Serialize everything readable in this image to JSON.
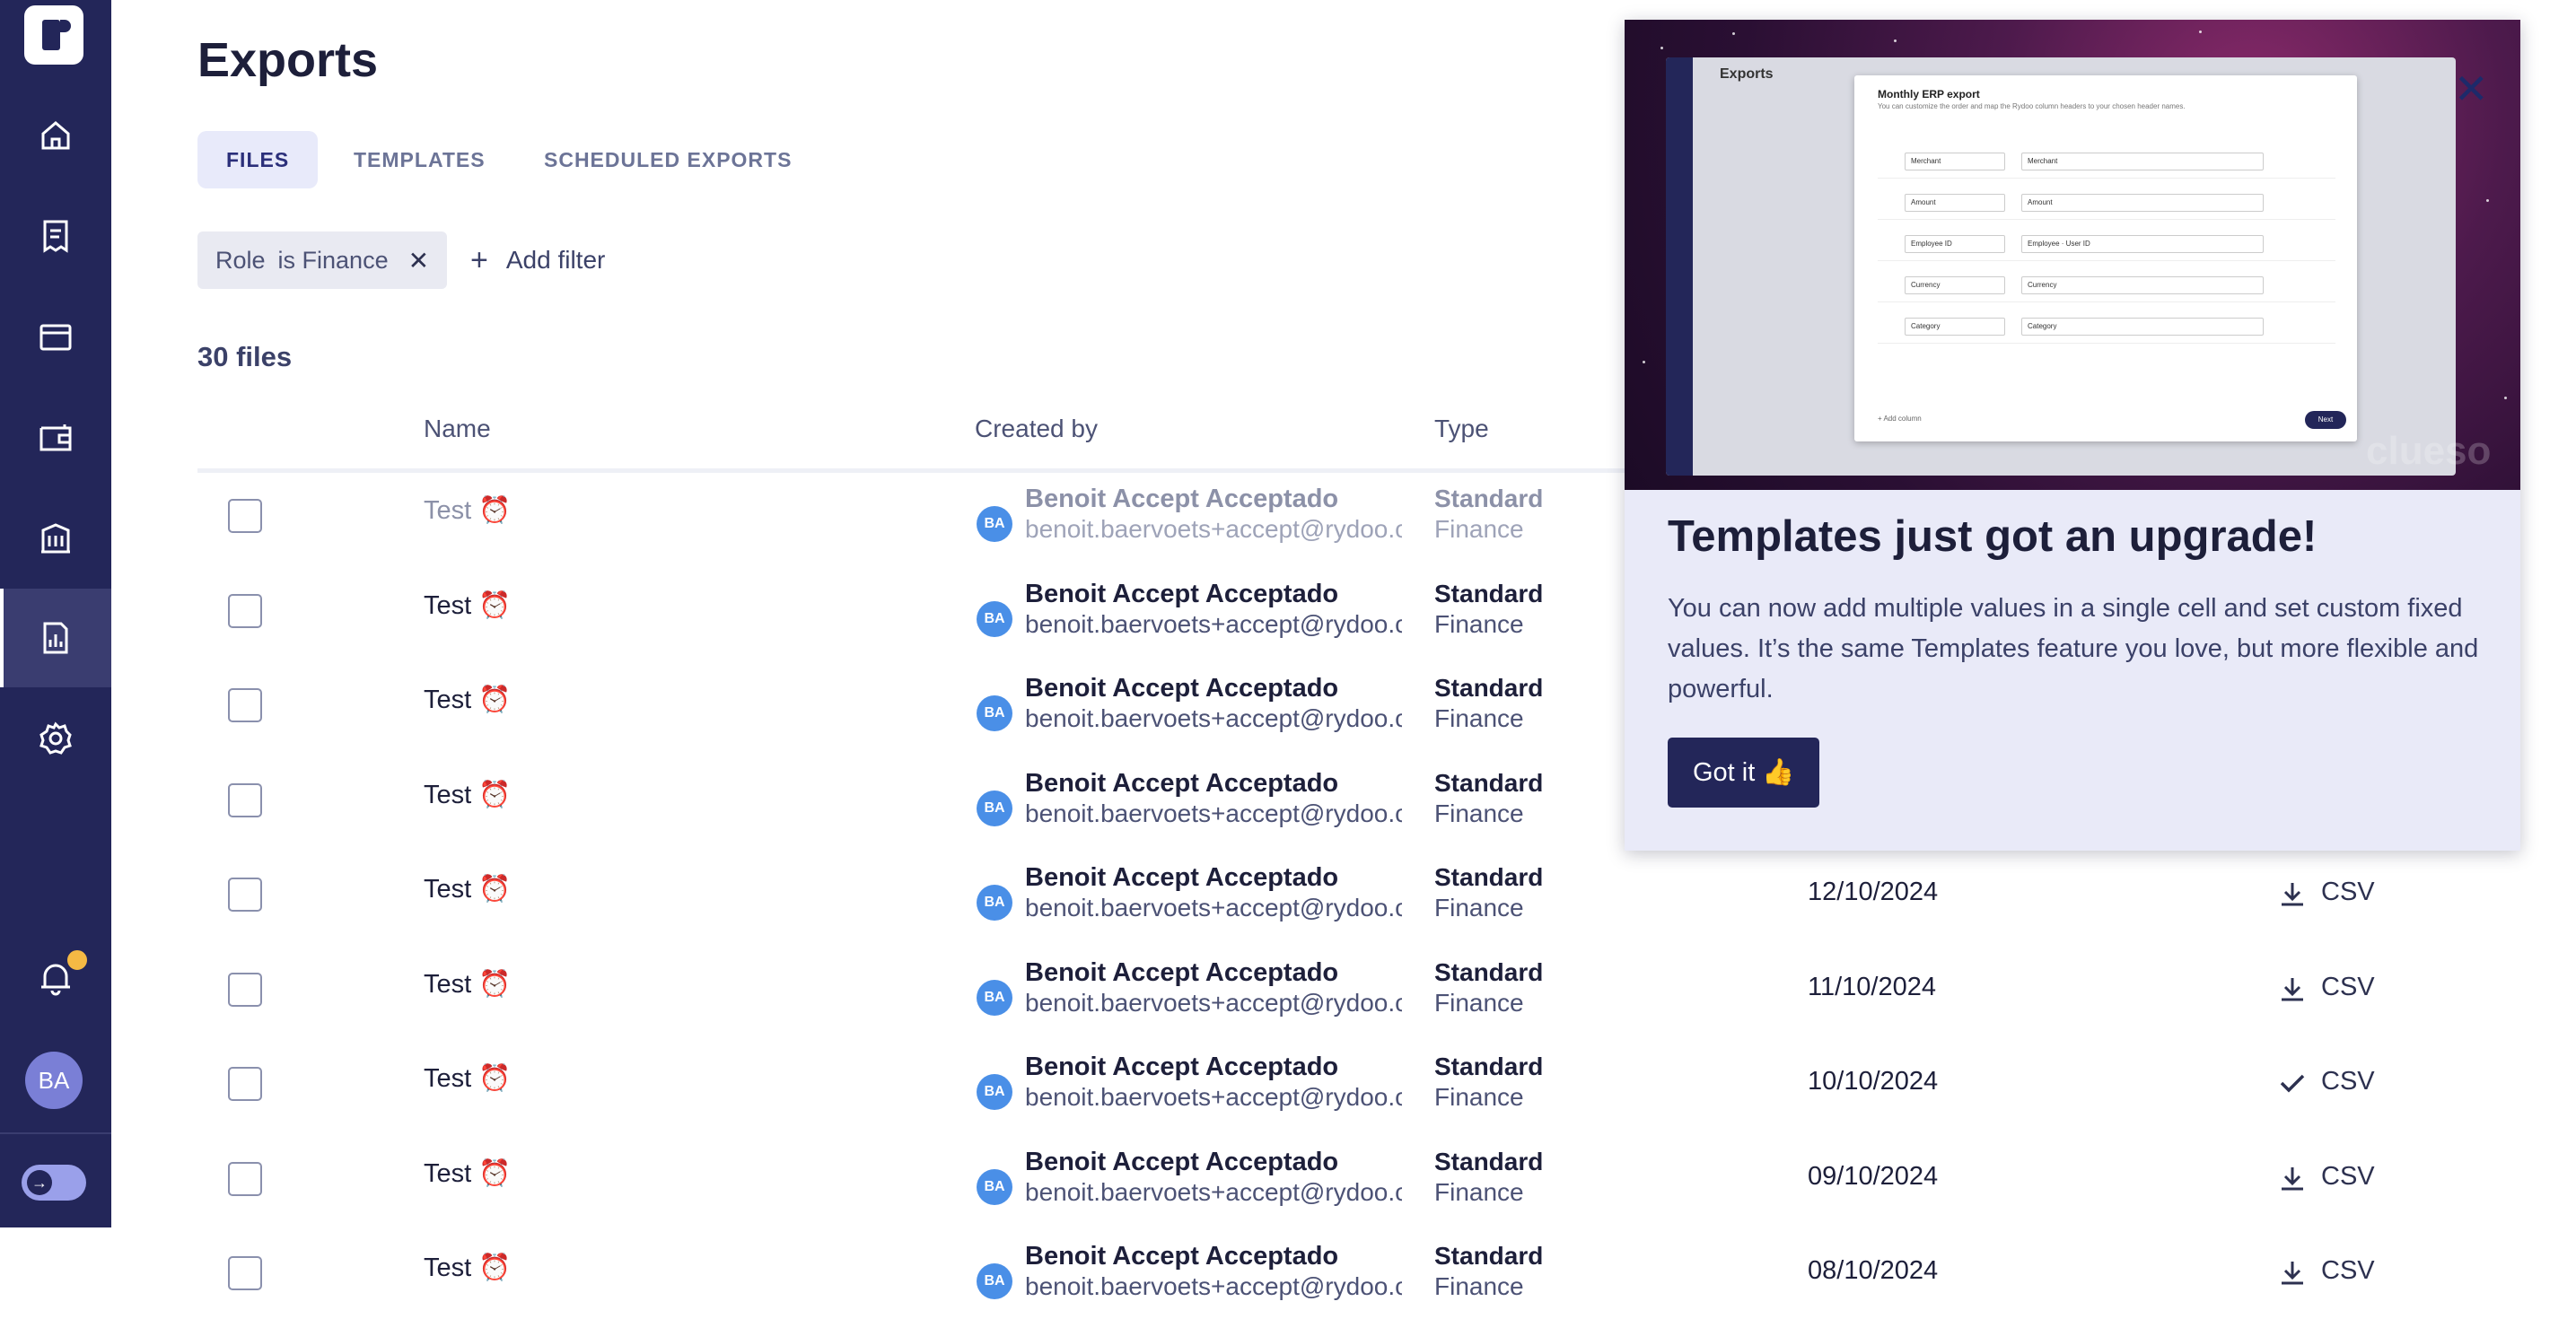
{
  "page": {
    "title": "Exports"
  },
  "tabs": [
    {
      "label": "FILES"
    },
    {
      "label": "TEMPLATES"
    },
    {
      "label": "SCHEDULED EXPORTS"
    }
  ],
  "filter": {
    "field": "Role",
    "condition": "is Finance",
    "add_label": "Add filter"
  },
  "file_count": "30 files",
  "columns": {
    "name": "Name",
    "created_by": "Created by",
    "type": "Type"
  },
  "rows": [
    {
      "name": "Test ⏰",
      "initials": "BA",
      "creator": "Benoit Accept Acceptado",
      "email": "benoit.baervoets+accept@rydoo.com",
      "type": "Standard",
      "subtype": "Finance",
      "date": "",
      "format": "",
      "status_icon": ""
    },
    {
      "name": "Test ⏰",
      "initials": "BA",
      "creator": "Benoit Accept Acceptado",
      "email": "benoit.baervoets+accept@rydoo.com",
      "type": "Standard",
      "subtype": "Finance",
      "date": "",
      "format": "",
      "status_icon": ""
    },
    {
      "name": "Test ⏰",
      "initials": "BA",
      "creator": "Benoit Accept Acceptado",
      "email": "benoit.baervoets+accept@rydoo.com",
      "type": "Standard",
      "subtype": "Finance",
      "date": "",
      "format": "",
      "status_icon": ""
    },
    {
      "name": "Test ⏰",
      "initials": "BA",
      "creator": "Benoit Accept Acceptado",
      "email": "benoit.baervoets+accept@rydoo.com",
      "type": "Standard",
      "subtype": "Finance",
      "date": "",
      "format": "",
      "status_icon": ""
    },
    {
      "name": "Test ⏰",
      "initials": "BA",
      "creator": "Benoit Accept Acceptado",
      "email": "benoit.baervoets+accept@rydoo.com",
      "type": "Standard",
      "subtype": "Finance",
      "date": "12/10/2024",
      "format": "CSV",
      "status_icon": "download-icon"
    },
    {
      "name": "Test ⏰",
      "initials": "BA",
      "creator": "Benoit Accept Acceptado",
      "email": "benoit.baervoets+accept@rydoo.com",
      "type": "Standard",
      "subtype": "Finance",
      "date": "11/10/2024",
      "format": "CSV",
      "status_icon": "download-icon"
    },
    {
      "name": "Test ⏰",
      "initials": "BA",
      "creator": "Benoit Accept Acceptado",
      "email": "benoit.baervoets+accept@rydoo.com",
      "type": "Standard",
      "subtype": "Finance",
      "date": "10/10/2024",
      "format": "CSV",
      "status_icon": "check-icon"
    },
    {
      "name": "Test ⏰",
      "initials": "BA",
      "creator": "Benoit Accept Acceptado",
      "email": "benoit.baervoets+accept@rydoo.com",
      "type": "Standard",
      "subtype": "Finance",
      "date": "09/10/2024",
      "format": "CSV",
      "status_icon": "download-icon"
    },
    {
      "name": "Test ⏰",
      "initials": "BA",
      "creator": "Benoit Accept Acceptado",
      "email": "benoit.baervoets+accept@rydoo.com",
      "type": "Standard",
      "subtype": "Finance",
      "date": "08/10/2024",
      "format": "CSV",
      "status_icon": "download-icon"
    }
  ],
  "user": {
    "initials": "BA"
  },
  "popup": {
    "title": "Templates just got an upgrade!",
    "body": "You can now add multiple values in a single cell and set custom fixed values. It’s the same Templates feature you love, but more flexible and powerful.",
    "button": "Got it 👍",
    "watermark": "clueso",
    "preview": {
      "page_title": "Exports",
      "modal_title": "Monthly ERP export",
      "modal_subtitle": "You can customize the order and map the Rydoo column headers to your chosen header names.",
      "fields": [
        "Merchant",
        "Amount",
        "Employee ID",
        "Currency",
        "Category"
      ],
      "add_column": "+ Add column",
      "next": "Next"
    }
  },
  "colors": {
    "sidebar": "#232659",
    "accent": "#2b2f7a",
    "active_tab_bg": "#e8eafa",
    "popup_bg": "#e9eaf8",
    "avatar_blue": "#4a8fe7",
    "notification_dot": "#f5b944"
  }
}
